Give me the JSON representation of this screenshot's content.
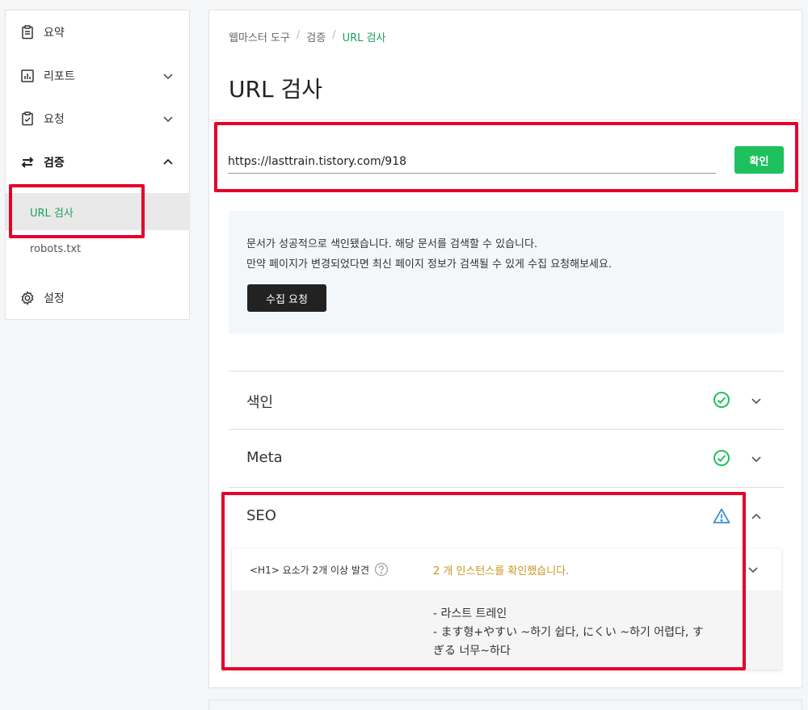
{
  "sidebar": {
    "items": [
      {
        "label": "요약",
        "icon": "document-icon"
      },
      {
        "label": "리포트",
        "icon": "chart-icon"
      },
      {
        "label": "요청",
        "icon": "clipboard-check-icon"
      },
      {
        "label": "검증",
        "icon": "swap-arrows-icon"
      }
    ],
    "sub_items": [
      {
        "label": "URL 검사"
      },
      {
        "label": "robots.txt"
      }
    ],
    "settings": {
      "label": "설정",
      "icon": "gear-icon"
    }
  },
  "main": {
    "breadcrumb": [
      "웹마스터 도구",
      "검증",
      "URL 검사"
    ],
    "title": "URL 검사",
    "url_input": {
      "value": "https://lasttrain.tistory.com/918"
    },
    "confirm_label": "확인",
    "info": {
      "line1": "문서가 성공적으로 색인됐습니다. 해당 문서를 검색할 수 있습니다.",
      "line2": "만약 페이지가 변경되었다면 최신 페이지 정보가 검색될 수 있게 수집 요청해보세요.",
      "button": "수집 요청"
    },
    "sections": [
      {
        "label": "색인",
        "status": "ok"
      },
      {
        "label": "Meta",
        "status": "ok"
      },
      {
        "label": "SEO",
        "status": "warning"
      }
    ],
    "seo_detail": {
      "rule": "<H1> 요소가 2개 이상 발견",
      "result": "2 개 인스턴스를 확인했습니다.",
      "instances": [
        "- 라스트 트레인",
        "- ます형+やすい ~하기 쉽다, にくい ~하기 어렵다, す",
        "ぎる 너무~하다"
      ]
    }
  },
  "colors": {
    "accent_green": "#1aa35c",
    "button_green": "#1ec15d",
    "warning_blue": "#3a8fd0",
    "highlight_red": "#e5002a",
    "result_orange": "#c8961c"
  }
}
